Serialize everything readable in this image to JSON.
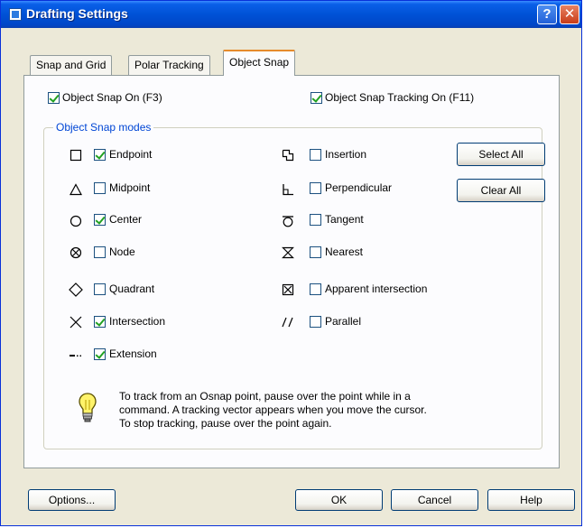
{
  "window": {
    "title": "Drafting Settings",
    "help_button": "?",
    "close_button": "✕"
  },
  "tabs": [
    {
      "label": "Snap and Grid"
    },
    {
      "label": "Polar Tracking"
    },
    {
      "label": "Object Snap"
    }
  ],
  "options": {
    "snap_on": {
      "label": "Object Snap On (F3)",
      "checked": true
    },
    "tracking_on": {
      "label": "Object Snap Tracking On (F11)",
      "checked": true
    }
  },
  "modes_group": {
    "title": "Object Snap modes",
    "left": [
      {
        "label": "Endpoint",
        "checked": true,
        "icon": "endpoint-square-icon"
      },
      {
        "label": "Midpoint",
        "checked": false,
        "icon": "midpoint-triangle-icon"
      },
      {
        "label": "Center",
        "checked": true,
        "icon": "center-circle-icon"
      },
      {
        "label": "Node",
        "checked": false,
        "icon": "node-icon"
      },
      {
        "label": "Quadrant",
        "checked": false,
        "icon": "quadrant-diamond-icon"
      },
      {
        "label": "Intersection",
        "checked": true,
        "icon": "intersection-x-icon"
      },
      {
        "label": "Extension",
        "checked": true,
        "icon": "extension-icon"
      }
    ],
    "right": [
      {
        "label": "Insertion",
        "checked": false,
        "icon": "insertion-icon"
      },
      {
        "label": "Perpendicular",
        "checked": false,
        "icon": "perpendicular-icon"
      },
      {
        "label": "Tangent",
        "checked": false,
        "icon": "tangent-icon"
      },
      {
        "label": "Nearest",
        "checked": false,
        "icon": "nearest-hourglass-icon"
      },
      {
        "label": "Apparent intersection",
        "checked": false,
        "icon": "apparent-intersection-icon"
      },
      {
        "label": "Parallel",
        "checked": false,
        "icon": "parallel-icon"
      }
    ],
    "select_all": "Select All",
    "clear_all": "Clear All"
  },
  "tip": {
    "line1": "To track from an Osnap point, pause over the point while in a",
    "line2": "command.  A tracking vector appears when you move the cursor.",
    "line3": "To stop tracking, pause over the point again.",
    "icon": "lightbulb-icon"
  },
  "footer": {
    "options": "Options...",
    "ok": "OK",
    "cancel": "Cancel",
    "help": "Help"
  },
  "colors": {
    "accent": "#0046D5",
    "check": "#21A121",
    "titlebar": "#0052D6",
    "dialog_bg": "#ECE9D8"
  }
}
